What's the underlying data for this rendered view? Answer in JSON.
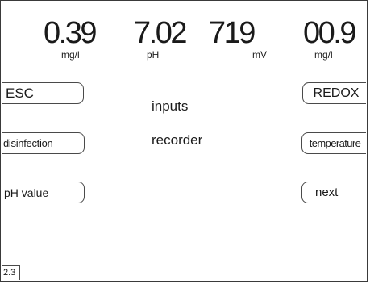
{
  "readings": {
    "chlorine": {
      "value": "0.39",
      "unit": "mg/l"
    },
    "ph": {
      "value": "7.02",
      "unit": "pH"
    },
    "redox": {
      "value": "719",
      "unit": "mV"
    },
    "free": {
      "value": "00.9",
      "unit": "mg/l"
    }
  },
  "left_keys": {
    "esc": "ESC",
    "disinfection": "disinfection",
    "ph_value": "pH value"
  },
  "right_keys": {
    "redox": "REDOX",
    "temperature": "temperature",
    "next": "next"
  },
  "menu": {
    "inputs": "inputs",
    "recorder": "recorder"
  },
  "page_indicator": "2.3"
}
